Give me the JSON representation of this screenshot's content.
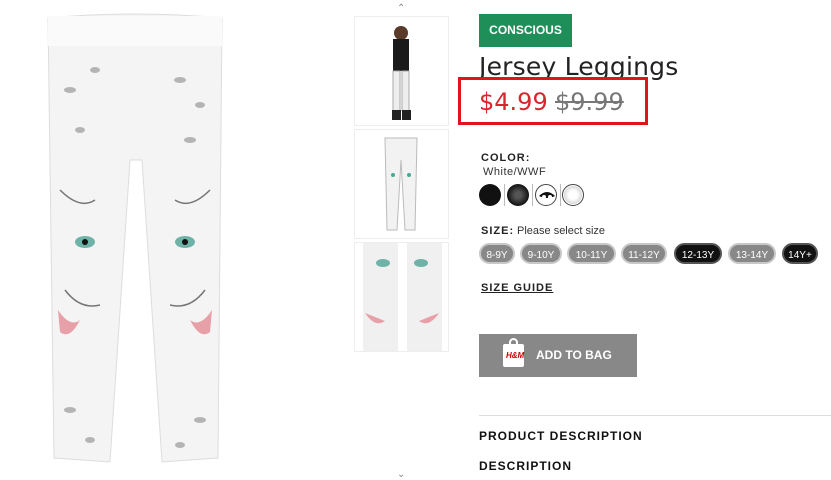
{
  "product": {
    "badge": "CONSCIOUS",
    "title": "Jersey Leggings",
    "price": "$4.99",
    "old_price": "$9.99"
  },
  "color": {
    "label": "COLOR:",
    "value": "White/WWF",
    "swatches": [
      "#111111",
      "#2a2a2a",
      "#ffffff",
      "#eeeeee"
    ]
  },
  "size": {
    "label": "SIZE:",
    "hint": "Please select size",
    "options": [
      "8-9Y",
      "9-10Y",
      "10-11Y",
      "11-12Y",
      "12-13Y",
      "13-14Y",
      "14Y+"
    ],
    "available": [
      "12-13Y",
      "14Y+"
    ]
  },
  "size_guide": "SIZE GUIDE",
  "add_to_bag": "ADD TO BAG",
  "bag_icon_text": "H&M",
  "sections": [
    "PRODUCT DESCRIPTION",
    "DESCRIPTION"
  ],
  "accent": {
    "badge": "#1f8f5a",
    "price": "#d7262f",
    "highlight": "#e0141e"
  }
}
